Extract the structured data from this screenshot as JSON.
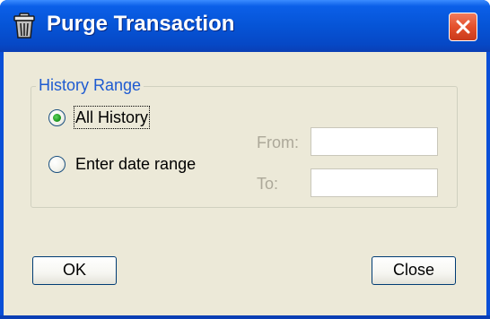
{
  "window": {
    "title": "Purge Transaction",
    "title_icon": "trash-can-icon",
    "close_icon": "close-x-icon"
  },
  "history_range": {
    "legend": "History Range",
    "options": [
      {
        "label": "All History",
        "checked": true
      },
      {
        "label": "Enter date range",
        "checked": false
      }
    ],
    "from_label": "From:",
    "to_label": "To:",
    "from_value": "",
    "to_value": ""
  },
  "buttons": {
    "ok": "OK",
    "close": "Close"
  },
  "colors": {
    "titlebar": "#0654d6",
    "client": "#ece9d8",
    "legend_text": "#1e5bd1",
    "disabled_text": "#aca899",
    "close_button": "#e4502c"
  }
}
